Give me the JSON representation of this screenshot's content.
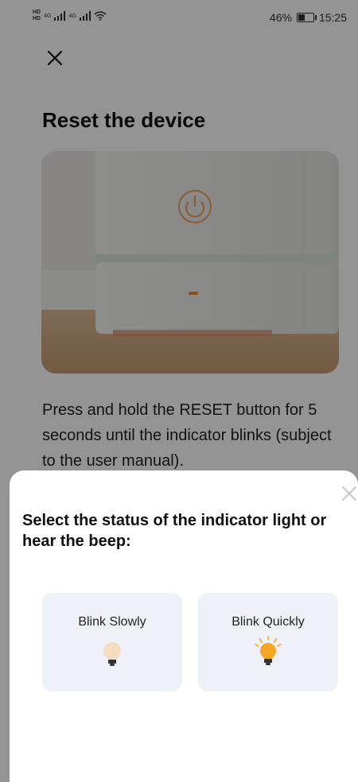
{
  "statusbar": {
    "hd1": "HD",
    "hd2": "HD",
    "net1": "4G",
    "net2": "4G",
    "battery_text": "46%",
    "battery_level": 46,
    "time": "15:25"
  },
  "page": {
    "title": "Reset the device",
    "instruction": "Press and hold the RESET button for 5 seconds until the indicator blinks (subject to the user manual)."
  },
  "sheet": {
    "title": "Select the status of the indicator light or hear the beep:",
    "options": [
      {
        "label": "Blink Slowly"
      },
      {
        "label": "Blink Quickly"
      }
    ]
  },
  "icons": {
    "close_top": "close-icon",
    "sheet_close": "close-icon",
    "bulb_slow": "lightbulb-icon",
    "bulb_quick": "lightbulb-glowing-icon",
    "nav": [
      "chevron-down-icon",
      "square-icon",
      "circle-icon",
      "triangle-back-icon"
    ]
  },
  "colors": {
    "bulb_slow": "#f6dcc0",
    "bulb_quick": "#f5a623",
    "option_bg": "#eef2f8"
  }
}
